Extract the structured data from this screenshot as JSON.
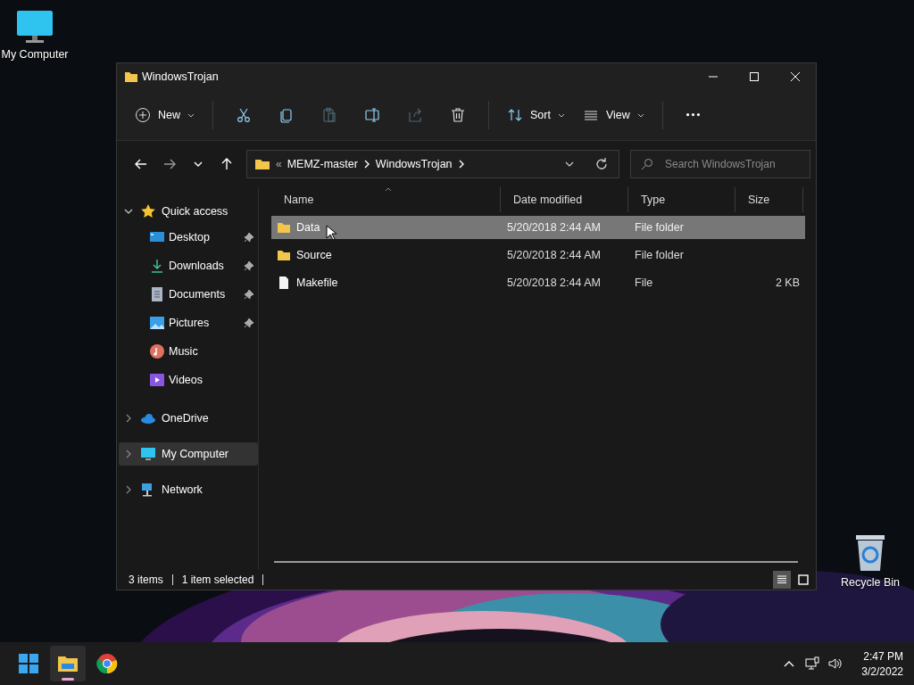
{
  "desktop_icons": [
    {
      "label": "My Computer",
      "kind": "computer"
    },
    {
      "label": "Recycle Bin",
      "kind": "recycle"
    }
  ],
  "window": {
    "title": "WindowsTrojan"
  },
  "toolbar": [
    {
      "kind": "new",
      "label": "New",
      "disabled": false
    },
    {
      "kind": "sep"
    },
    {
      "kind": "cut",
      "disabled": false
    },
    {
      "kind": "copy",
      "disabled": false
    },
    {
      "kind": "paste",
      "disabled": true
    },
    {
      "kind": "rename",
      "disabled": false
    },
    {
      "kind": "share",
      "disabled": true
    },
    {
      "kind": "delete",
      "disabled": false
    },
    {
      "kind": "sep"
    },
    {
      "kind": "sort",
      "label": "Sort",
      "disabled": false
    },
    {
      "kind": "view",
      "label": "View",
      "disabled": false
    },
    {
      "kind": "sep"
    },
    {
      "kind": "more",
      "disabled": false
    }
  ],
  "address": {
    "overflow": "«",
    "segments": [
      "MEMZ-master",
      "WindowsTrojan"
    ]
  },
  "search": {
    "placeholder": "Search WindowsTrojan"
  },
  "nav": [
    {
      "label": "Quick access",
      "kind": "star",
      "expanded": true,
      "selected": false,
      "children": [
        {
          "label": "Desktop",
          "kind": "desktop",
          "pinned": true,
          "selected": false
        },
        {
          "label": "Downloads",
          "kind": "download",
          "pinned": true,
          "selected": false
        },
        {
          "label": "Documents",
          "kind": "document",
          "pinned": true,
          "selected": false
        },
        {
          "label": "Pictures",
          "kind": "pictures",
          "pinned": true,
          "selected": false
        },
        {
          "label": "Music",
          "kind": "music",
          "pinned": false,
          "selected": false
        },
        {
          "label": "Videos",
          "kind": "videos",
          "pinned": false,
          "selected": false
        }
      ]
    },
    {
      "label": "OneDrive",
      "kind": "cloud",
      "expanded": false,
      "selected": false
    },
    {
      "label": "My Computer",
      "kind": "computer",
      "expanded": false,
      "selected": true
    },
    {
      "label": "Network",
      "kind": "network",
      "expanded": false,
      "selected": false
    }
  ],
  "table": {
    "columns": [
      "Name",
      "Date modified",
      "Type",
      "Size"
    ],
    "rows": [
      {
        "kind": "folder",
        "name": "Data",
        "date": "5/20/2018 2:44 AM",
        "type": "File folder",
        "size": "",
        "selected": true
      },
      {
        "kind": "folder",
        "name": "Source",
        "date": "5/20/2018 2:44 AM",
        "type": "File folder",
        "size": "",
        "selected": false
      },
      {
        "kind": "file",
        "name": "Makefile",
        "date": "5/20/2018 2:44 AM",
        "type": "File",
        "size": "2 KB",
        "selected": false
      }
    ]
  },
  "status_bar": {
    "count": "3 items",
    "selection": "1 item selected",
    "view": [
      {
        "kind": "details",
        "selected": true
      },
      {
        "kind": "tiles",
        "selected": false
      }
    ]
  },
  "taskbar": {
    "apps": [
      {
        "kind": "start",
        "active": false
      },
      {
        "kind": "explorer",
        "active": true
      },
      {
        "kind": "chrome",
        "active": false
      }
    ],
    "time": "2:47 PM",
    "date": "3/2/2022"
  }
}
